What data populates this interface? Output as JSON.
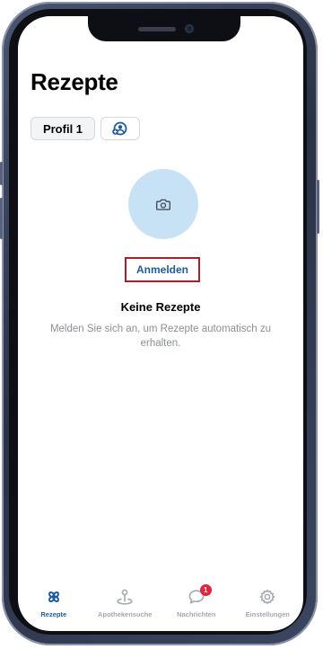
{
  "header": {
    "title": "Rezepte"
  },
  "profiles": {
    "active_label": "Profil 1",
    "add_icon": "add-person-icon"
  },
  "avatar": {
    "icon": "camera-icon",
    "color": "#c7e1f5"
  },
  "login": {
    "label": "Anmelden"
  },
  "empty_state": {
    "title": "Keine Rezepte",
    "text": "Melden Sie sich an, um Rezepte automatisch zu erhalten."
  },
  "tabbar": {
    "items": [
      {
        "label": "Rezepte",
        "icon": "prescription-icon",
        "active": true
      },
      {
        "label": "Apothekensuche",
        "icon": "pharmacy-pin-icon",
        "active": false
      },
      {
        "label": "Nachrichten",
        "icon": "chat-bubble-icon",
        "active": false,
        "badge": "1"
      },
      {
        "label": "Einstellungen",
        "icon": "gear-icon",
        "active": false
      }
    ]
  },
  "colors": {
    "accent": "#1f5c9e",
    "highlight_border": "#b0192e",
    "badge": "#e0253d",
    "inactive": "#a4a8b0"
  }
}
